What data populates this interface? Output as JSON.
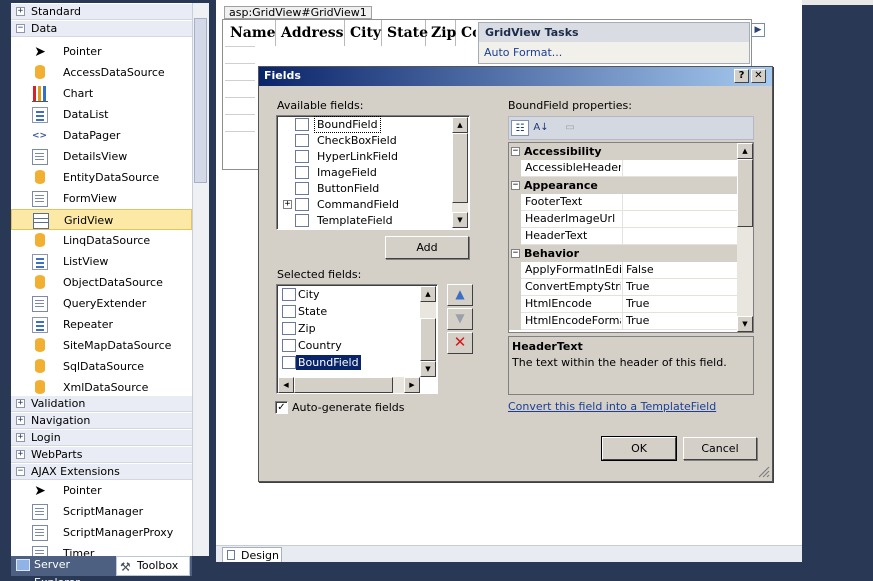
{
  "toolbox": {
    "categories_top": [
      {
        "label": "Standard",
        "sign": "+"
      },
      {
        "label": "Data",
        "sign": "−"
      }
    ],
    "data_items": [
      {
        "label": "Pointer",
        "icon": "pointer-icon"
      },
      {
        "label": "AccessDataSource",
        "icon": "database-icon"
      },
      {
        "label": "Chart",
        "icon": "bar-chart-icon"
      },
      {
        "label": "DataList",
        "icon": "list-icon"
      },
      {
        "label": "DataPager",
        "icon": "pager-icon"
      },
      {
        "label": "DetailsView",
        "icon": "form-icon"
      },
      {
        "label": "EntityDataSource",
        "icon": "database-icon"
      },
      {
        "label": "FormView",
        "icon": "form-icon"
      },
      {
        "label": "GridView",
        "icon": "grid-icon"
      },
      {
        "label": "LinqDataSource",
        "icon": "database-icon"
      },
      {
        "label": "ListView",
        "icon": "list-icon"
      },
      {
        "label": "ObjectDataSource",
        "icon": "database-icon"
      },
      {
        "label": "QueryExtender",
        "icon": "form-icon"
      },
      {
        "label": "Repeater",
        "icon": "list-icon"
      },
      {
        "label": "SiteMapDataSource",
        "icon": "database-icon"
      },
      {
        "label": "SqlDataSource",
        "icon": "database-icon"
      },
      {
        "label": "XmlDataSource",
        "icon": "database-icon"
      }
    ],
    "selected_item": "GridView",
    "categories_bottom": [
      {
        "label": "Validation",
        "sign": "+"
      },
      {
        "label": "Navigation",
        "sign": "+"
      },
      {
        "label": "Login",
        "sign": "+"
      },
      {
        "label": "WebParts",
        "sign": "+"
      },
      {
        "label": "AJAX Extensions",
        "sign": "−"
      }
    ],
    "ajax_items": [
      {
        "label": "Pointer",
        "icon": "pointer-icon"
      },
      {
        "label": "ScriptManager",
        "icon": "form-icon"
      },
      {
        "label": "ScriptManagerProxy",
        "icon": "form-icon"
      },
      {
        "label": "Timer",
        "icon": "form-icon"
      }
    ],
    "tabs": {
      "server_explorer": "Server Explorer",
      "toolbox": "Toolbox"
    }
  },
  "designer": {
    "tag_label": "asp:GridView#GridView1",
    "columns": [
      "Name",
      "Address",
      "City",
      "State",
      "Zip",
      "Co"
    ],
    "tasks_title": "GridView Tasks",
    "tasks_link": "Auto Format...",
    "design_tab": "Design"
  },
  "dialog": {
    "title": "Fields",
    "help_button": "?",
    "close_button": "✕",
    "available_label": "Available fields:",
    "available_fields": [
      {
        "label": "BoundField",
        "icon": "boundfield-icon",
        "selected": true
      },
      {
        "label": "CheckBoxField",
        "icon": "checkbox-field-icon"
      },
      {
        "label": "HyperLinkField",
        "icon": "hyperlink-field-icon"
      },
      {
        "label": "ImageField",
        "icon": "image-field-icon"
      },
      {
        "label": "ButtonField",
        "icon": "button-field-icon"
      },
      {
        "label": "CommandField",
        "icon": "command-field-icon",
        "expandable": true
      },
      {
        "label": "TemplateField",
        "icon": "template-field-icon"
      }
    ],
    "add_button": "Add",
    "selected_label": "Selected fields:",
    "selected_fields": [
      {
        "label": "City"
      },
      {
        "label": "State"
      },
      {
        "label": "Zip"
      },
      {
        "label": "Country"
      },
      {
        "label": "BoundField",
        "selected": true
      }
    ],
    "auto_generate_label": "Auto-generate fields",
    "auto_generate_checked": true,
    "props_label": "BoundField properties:",
    "property_grid": [
      {
        "category": "Accessibility",
        "rows": [
          {
            "name": "AccessibleHeaderTe",
            "value": ""
          }
        ]
      },
      {
        "category": "Appearance",
        "rows": [
          {
            "name": "FooterText",
            "value": ""
          },
          {
            "name": "HeaderImageUrl",
            "value": ""
          },
          {
            "name": "HeaderText",
            "value": ""
          }
        ]
      },
      {
        "category": "Behavior",
        "rows": [
          {
            "name": "ApplyFormatInEditM",
            "value": "False"
          },
          {
            "name": "ConvertEmptyString",
            "value": "True"
          },
          {
            "name": "HtmlEncode",
            "value": "True"
          },
          {
            "name": "HtmlEncodeFormatS",
            "value": "True"
          }
        ]
      }
    ],
    "desc_title": "HeaderText",
    "desc_text": "The text within the header of this field.",
    "convert_link": "Convert this field into a TemplateField",
    "ok_button": "OK",
    "cancel_button": "Cancel"
  },
  "colors": {
    "title_start": "#0a246a",
    "title_end": "#a6caf0",
    "selection": "#0a246a",
    "toolbox_selected": "#fbe9a5",
    "link": "#1c3f95",
    "delete_icon": "#d11a1a",
    "move_icon": "#3a6fc4"
  }
}
